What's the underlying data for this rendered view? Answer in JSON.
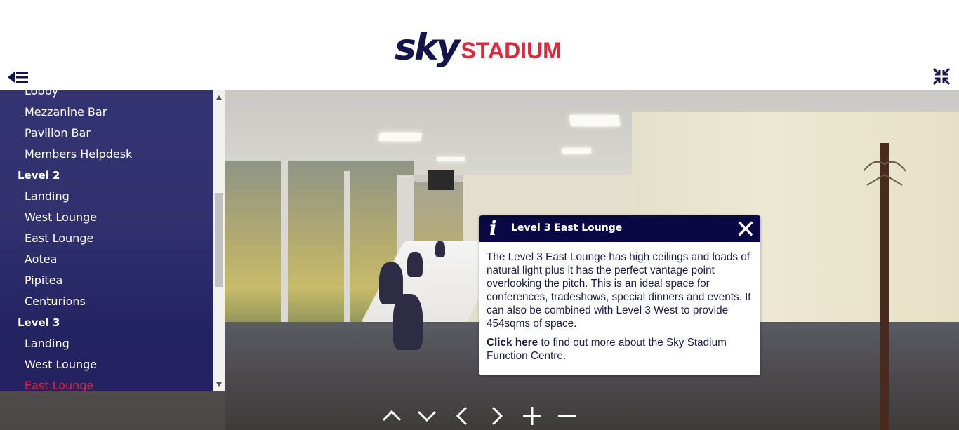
{
  "header": {
    "logo_sky": "sky",
    "logo_stadium": "STADIUM",
    "brand_navy": "#14144a",
    "brand_red": "#e0283c"
  },
  "sidebar": {
    "items": [
      {
        "label": "Lobby",
        "type": "item"
      },
      {
        "label": "Mezzanine Bar",
        "type": "item"
      },
      {
        "label": "Pavilion Bar",
        "type": "item"
      },
      {
        "label": "Members Helpdesk",
        "type": "item"
      },
      {
        "label": "Level 2",
        "type": "heading"
      },
      {
        "label": "Landing",
        "type": "item"
      },
      {
        "label": "West Lounge",
        "type": "item"
      },
      {
        "label": "East Lounge",
        "type": "item"
      },
      {
        "label": "Aotea",
        "type": "item"
      },
      {
        "label": "Pipitea",
        "type": "item"
      },
      {
        "label": "Centurions",
        "type": "item"
      },
      {
        "label": "Level 3",
        "type": "heading"
      },
      {
        "label": "Landing",
        "type": "item"
      },
      {
        "label": "West Lounge",
        "type": "item"
      },
      {
        "label": "East Lounge",
        "type": "item",
        "active": true
      }
    ]
  },
  "popup": {
    "title": "Level 3 East Lounge",
    "body": "The Level 3 East Lounge has high ceilings and loads of natural light plus it has the perfect vantage point overlooking the pitch. This is an ideal space for conferences, tradeshows, special dinners and events. It can also be combined with Level 3 West to provide 454sqms of space.",
    "link_label": "Click here",
    "link_suffix": " to find out more about the Sky Stadium Function Centre."
  },
  "icons": {
    "menu_toggle": "menu-collapse-icon",
    "fullscreen": "fullscreen-exit-icon",
    "close": "close-icon",
    "info": "info-icon",
    "nav": [
      "up-arrow-icon",
      "down-arrow-icon",
      "left-arrow-icon",
      "right-arrow-icon",
      "zoom-in-icon",
      "zoom-out-icon"
    ]
  }
}
